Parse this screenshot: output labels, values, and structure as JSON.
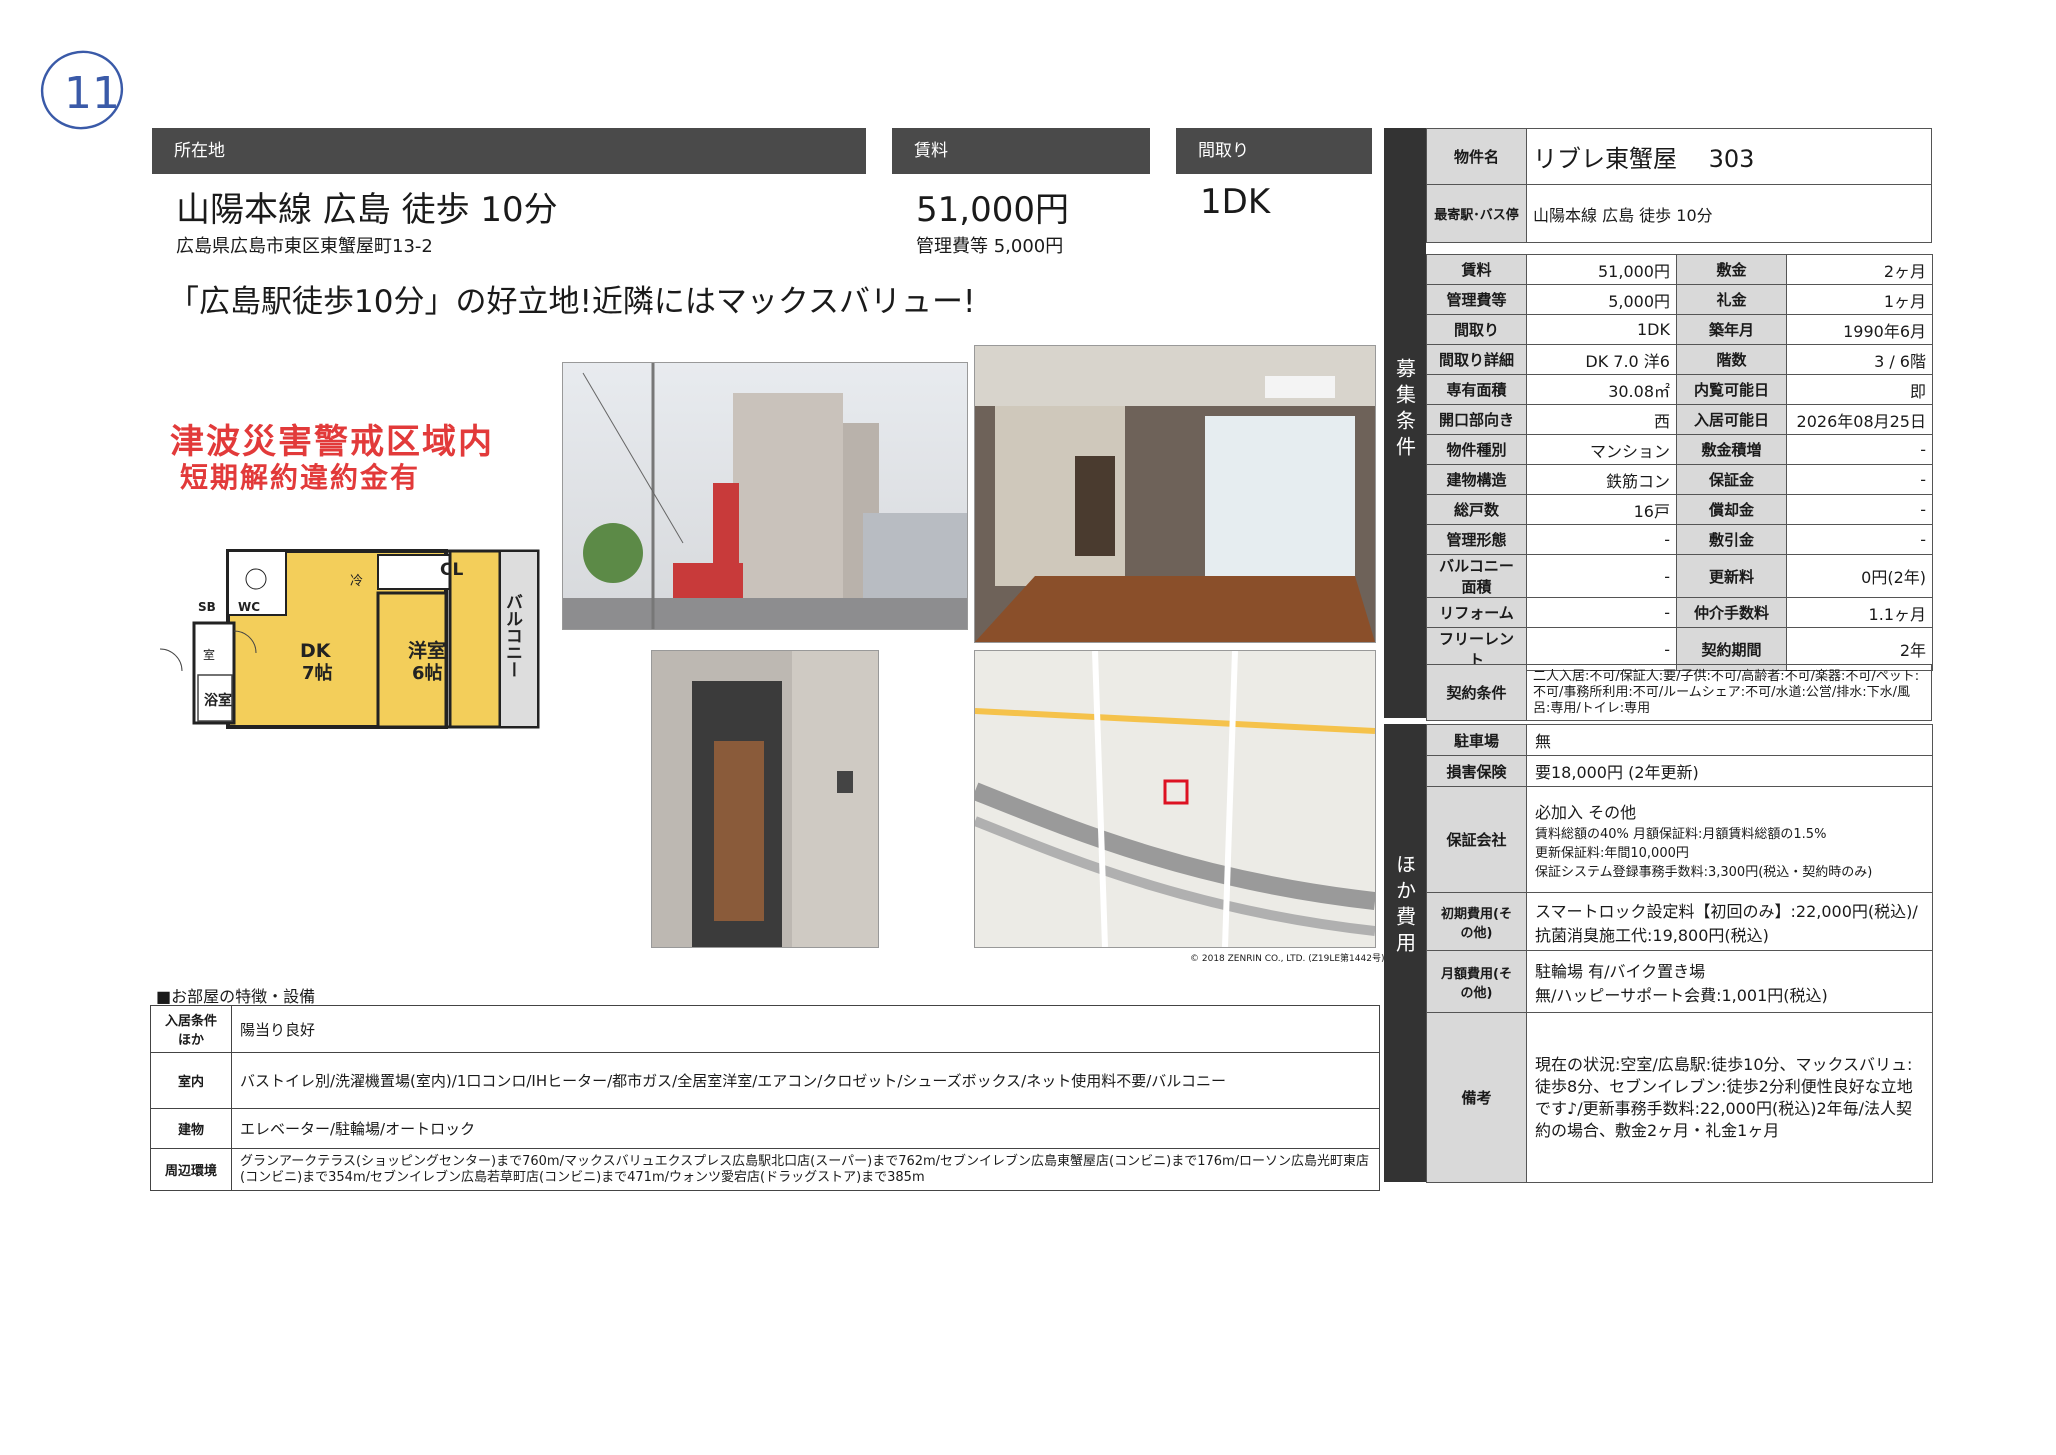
{
  "handwritten_mark": "11",
  "header": {
    "location_label": "所在地",
    "rent_label": "賃料",
    "layout_label": "間取り"
  },
  "summary": {
    "access": "山陽本線 広島 徒歩 10分",
    "address": "広島県広島市東区東蟹屋町13-2",
    "rent": "51,000円",
    "management_fee": "管理費等 5,000円",
    "layout": "1DK",
    "tagline": "「広島駅徒歩10分」の好立地!近隣にはマックスバリュー!"
  },
  "warnings": {
    "tsunami": "津波災害警戒区域内",
    "penalty": "短期解約違約金有"
  },
  "floorplan": {
    "dk": "DK",
    "dk_size": "7帖",
    "western": "洋室",
    "western_size": "6帖",
    "balcony": "バルコニー",
    "cl": "CL",
    "wc": "WC",
    "sb": "SB",
    "bath": "浴室",
    "reizo": "冷",
    "shitsu": "室"
  },
  "map_credit": "© 2018 ZENRIN CO., LTD. (Z19LE第1442号)",
  "features": {
    "title": "■お部屋の特徴・設備",
    "rows": [
      {
        "label": "入居条件ほか",
        "value": "陽当り良好"
      },
      {
        "label": "室内",
        "value": "バストイレ別/洗濯機置場(室内)/1口コンロ/IHヒーター/都市ガス/全居室洋室/エアコン/クロゼット/シューズボックス/ネット使用料不要/バルコニー"
      },
      {
        "label": "建物",
        "value": "エレベーター/駐輪場/オートロック"
      },
      {
        "label": "周辺環境",
        "value": "グランアークテラス(ショッピングセンター)まで760m/マックスバリュエクスプレス広島駅北口店(スーパー)まで762m/セブンイレブン広島東蟹屋店(コンビニ)まで176m/ローソン広島光町東店(コンビニ)まで354m/セブンイレブン広島若草町店(コンビニ)まで471m/ウォンツ愛宕店(ドラッグストア)まで385m"
      }
    ]
  },
  "spec": {
    "side_label_1": "募集条件",
    "side_label_2": "ほか費用",
    "property_name_label": "物件名",
    "property_name": "リブレ東蟹屋　 303",
    "station_label": "最寄駅･バス停",
    "station": "山陽本線 広島 徒歩 10分",
    "rows": [
      [
        "賃料",
        "51,000円",
        "敷金",
        "2ヶ月"
      ],
      [
        "管理費等",
        "5,000円",
        "礼金",
        "1ヶ月"
      ],
      [
        "間取り",
        "1DK",
        "築年月",
        "1990年6月"
      ],
      [
        "間取り詳細",
        "DK 7.0 洋6",
        "階数",
        "3 / 6階"
      ],
      [
        "専有面積",
        "30.08㎡",
        "内覧可能日",
        "即"
      ],
      [
        "開口部向き",
        "西",
        "入居可能日",
        "2026年08月25日"
      ],
      [
        "物件種別",
        "マンション",
        "敷金積増",
        "-"
      ],
      [
        "建物構造",
        "鉄筋コン",
        "保証金",
        "-"
      ],
      [
        "総戸数",
        "16戸",
        "償却金",
        "-"
      ],
      [
        "管理形態",
        "-",
        "敷引金",
        "-"
      ],
      [
        "バルコニー面積",
        "-",
        "更新料",
        "0円(2年)"
      ],
      [
        "リフォーム",
        "-",
        "仲介手数料",
        "1.1ヶ月"
      ],
      [
        "フリーレント",
        "-",
        "契約期間",
        "2年"
      ]
    ],
    "contract_label": "契約条件",
    "contract": "二人入居:不可/保証人:要/子供:不可/高齢者:不可/楽器:不可/ペット:不可/事務所利用:不可/ルームシェア:不可/水道:公営/排水:下水/風呂:専用/トイレ:専用"
  },
  "other": {
    "parking_label": "駐車場",
    "parking": "無",
    "insurance_label": "損害保険",
    "insurance": "要18,000円 (2年更新)",
    "guarantee_label": "保証会社",
    "guarantee_1": "必加入 その他",
    "guarantee_2": "賃料総額の40% 月額保証料:月額賃料総額の1.5%",
    "guarantee_3": "更新保証料:年間10,000円",
    "guarantee_4": "保証システム登録事務手数料:3,300円(税込・契約時のみ)",
    "initial_label": "初期費用(その他)",
    "initial": "スマートロック設定料【初回のみ】:22,000円(税込)/抗菌消臭施工代:19,800円(税込)",
    "monthly_label": "月額費用(その他)",
    "monthly_1": "駐輪場 有/バイク置き場",
    "monthly_2": "無/ハッピーサポート会費:1,001円(税込)",
    "remarks_label": "備考",
    "remarks": "現在の状況:空室/広島駅:徒歩10分、マックスバリュ:徒歩8分、セブンイレブン:徒歩2分利便性良好な立地です♪/更新事務手数料:22,000円(税込)2年毎/法人契約の場合、敷金2ヶ月・礼金1ヶ月"
  }
}
